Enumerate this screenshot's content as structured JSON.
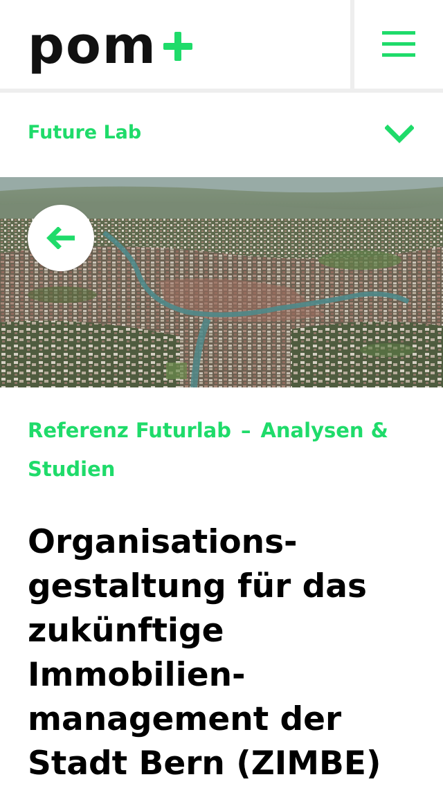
{
  "header": {
    "logo_text": "pom",
    "logo_plus": "+",
    "menu_label": "Menu"
  },
  "section": {
    "label": "Future Lab"
  },
  "hero": {
    "image_description": "Aerial photo of the city of Bern",
    "back_label": "Back"
  },
  "breadcrumb": {
    "first": "Referenz Futurlab",
    "separator": "–",
    "second": "Analysen & Studien"
  },
  "article": {
    "title": "Organisations-\ngestaltung für das\nzukünftige\nImmobilien-\nmanagement der\nStadt Bern (ZIMBE)"
  },
  "colors": {
    "accent": "#1fdb6a",
    "text": "#000000",
    "divider": "#eeeeee"
  },
  "icons": {
    "menu": "hamburger-icon",
    "dropdown": "chevron-down-icon",
    "back": "arrow-left-icon"
  }
}
